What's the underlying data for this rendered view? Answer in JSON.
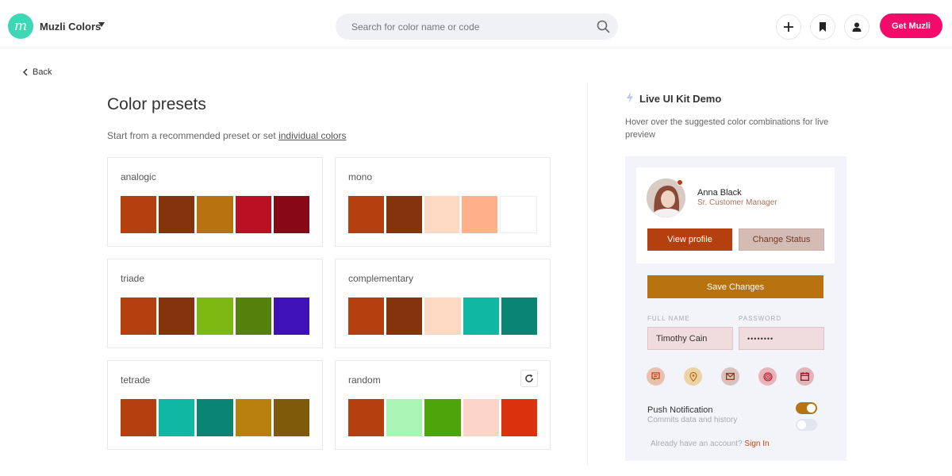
{
  "header": {
    "brand": "Muzli Colors",
    "search_placeholder": "Search for color name or code",
    "cta_label": "Get Muzli"
  },
  "nav": {
    "back_label": "Back"
  },
  "presets": {
    "title": "Color presets",
    "subtitle_text": "Start from a recommended preset or set ",
    "subtitle_link": "individual colors",
    "cards": [
      {
        "name": "analogic",
        "colors": [
          "#b4400f",
          "#84330c",
          "#b8720f",
          "#bb1023",
          "#880818"
        ]
      },
      {
        "name": "mono",
        "colors": [
          "#b4400f",
          "#84330c",
          "#fdd8c2",
          "#feb18a",
          "#ffffff"
        ]
      },
      {
        "name": "triade",
        "colors": [
          "#b4400f",
          "#84330c",
          "#7eb812",
          "#54800b",
          "#3e12b8"
        ]
      },
      {
        "name": "complementary",
        "colors": [
          "#b4400f",
          "#84330c",
          "#fdd8c2",
          "#0fb8a2",
          "#0a8473"
        ]
      },
      {
        "name": "tetrade",
        "colors": [
          "#b4400f",
          "#0fb8a2",
          "#0a8473",
          "#b8800f",
          "#805a0b"
        ]
      },
      {
        "name": "random",
        "colors": [
          "#b4400f",
          "#a8f5b6",
          "#4ea50a",
          "#fdd4c8",
          "#d9320c"
        ]
      }
    ]
  },
  "live_demo": {
    "title": "Live UI Kit Demo",
    "description": "Hover over the suggested color combinations for live preview",
    "user_name": "Anna Black",
    "user_role": "Sr. Customer Manager",
    "view_profile_label": "View profile",
    "change_status_label": "Change Status",
    "save_label": "Save Changes",
    "full_name_label": "FULL NAME",
    "full_name_value": "Timothy Cain",
    "password_label": "PASSWORD",
    "password_value": "••••••••",
    "push_title": "Push Notification",
    "push_subtitle": "Commits data and history",
    "account_text": "Already have an account? ",
    "sign_in_label": "Sign In",
    "toggle_on": true,
    "toggle_off": false
  },
  "colors": {
    "accent": "#f50a6b",
    "logo": "#3ed6b5",
    "primary": "#b4400f",
    "save": "#b8720f"
  }
}
